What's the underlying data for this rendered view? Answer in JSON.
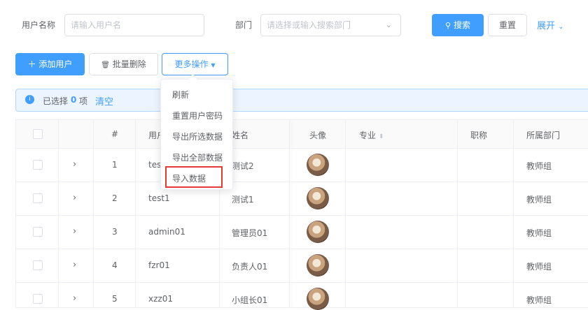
{
  "search": {
    "username_label": "用户名称",
    "username_placeholder": "请输入用户名",
    "dept_label": "部门",
    "dept_placeholder": "请选择或输入搜索部门",
    "search_button": "搜索",
    "reset_button": "重置",
    "expand_link": "展开"
  },
  "toolbar": {
    "add_user": "添加用户",
    "batch_delete": "批量删除",
    "more_actions": "更多操作"
  },
  "selection": {
    "prefix": "已选择",
    "count": "0",
    "suffix": "项",
    "clear": "清空"
  },
  "dropdown": {
    "items": [
      "刷新",
      "重置用户密码",
      "导出所选数据",
      "导出全部数据",
      "导入数据"
    ],
    "highlighted_index": 4
  },
  "table": {
    "headers": [
      "#",
      "用户",
      "姓名",
      "头像",
      "专业",
      "职称",
      "所属部门"
    ],
    "rows": [
      {
        "index": "1",
        "username": "test",
        "name": "测试2",
        "dept": "教师组"
      },
      {
        "index": "2",
        "username": "test1",
        "name": "测试1",
        "dept": "教师组"
      },
      {
        "index": "3",
        "username": "admin01",
        "name": "管理员01",
        "dept": "教师组"
      },
      {
        "index": "4",
        "username": "fzr01",
        "name": "负责人01",
        "dept": "教师组"
      },
      {
        "index": "5",
        "username": "xzz01",
        "name": "小组长01",
        "dept": "教师组"
      }
    ]
  },
  "colors": {
    "primary": "#409eff",
    "highlight": "#e53935"
  }
}
